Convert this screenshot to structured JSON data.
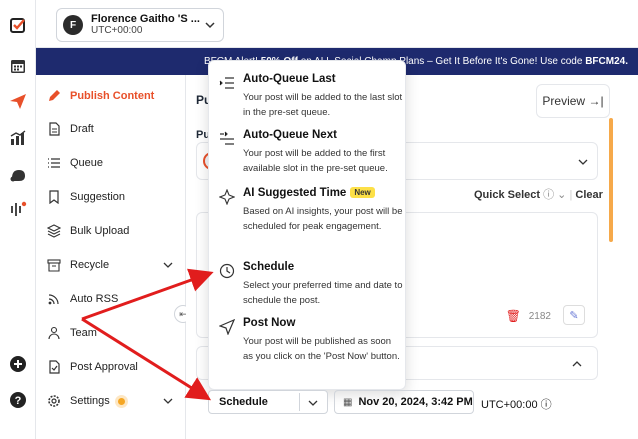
{
  "account": {
    "initial": "F",
    "name": "Florence Gaitho 'S ...",
    "timezone": "UTC+00:00"
  },
  "banner": {
    "prefix": "BFCM Alert!",
    "highlight": "50% Off",
    "text": " on ALL Social Champ Plans – Get It Before It's Gone! Use code ",
    "code": "BFCM24."
  },
  "sidebar": {
    "items": [
      {
        "label": "Publish Content",
        "icon": "pencil-icon"
      },
      {
        "label": "Draft",
        "icon": "document-icon"
      },
      {
        "label": "Queue",
        "icon": "list-icon"
      },
      {
        "label": "Suggestion",
        "icon": "bookmark-icon"
      },
      {
        "label": "Bulk Upload",
        "icon": "layers-icon"
      },
      {
        "label": "Recycle",
        "icon": "archive-icon"
      },
      {
        "label": "Auto RSS",
        "icon": "rss-icon"
      },
      {
        "label": "Team",
        "icon": "user-icon"
      },
      {
        "label": "Post Approval",
        "icon": "approval-icon"
      },
      {
        "label": "Settings",
        "icon": "gear-icon"
      }
    ]
  },
  "main": {
    "header_fragment": "Pu",
    "sub_fragment": "Pu",
    "preview_label": "Preview",
    "quick_select": "Quick Select",
    "clear": "Clear",
    "char_count": "2182"
  },
  "dropdown": {
    "options": [
      {
        "title": "Auto-Queue Last",
        "desc": "Your post will be added to the last slot in the pre-set queue.",
        "icon": "queue-last-icon"
      },
      {
        "title": "Auto-Queue Next",
        "desc": "Your post will be added to the first available slot in the pre-set queue.",
        "icon": "queue-next-icon"
      },
      {
        "title": "AI Suggested Time",
        "badge": "New",
        "desc": "Based on AI insights, your post will be scheduled for peak engagement.",
        "icon": "ai-sparkle-icon"
      },
      {
        "title": "Schedule",
        "desc": "Select your preferred time and date to schedule the post.",
        "icon": "clock-icon"
      },
      {
        "title": "Post Now",
        "desc": "Your post will be published as soon as you click on the 'Post Now' button.",
        "icon": "send-icon"
      }
    ]
  },
  "footer": {
    "schedule_select": "Schedule",
    "datetime": "Nov 20, 2024, 3:42 PM",
    "timezone": "UTC+00:00"
  },
  "colors": {
    "accent": "#e8502a",
    "banner_bg": "#1e2a6e",
    "arrow": "#e11d1d",
    "badge": "#fde047"
  }
}
